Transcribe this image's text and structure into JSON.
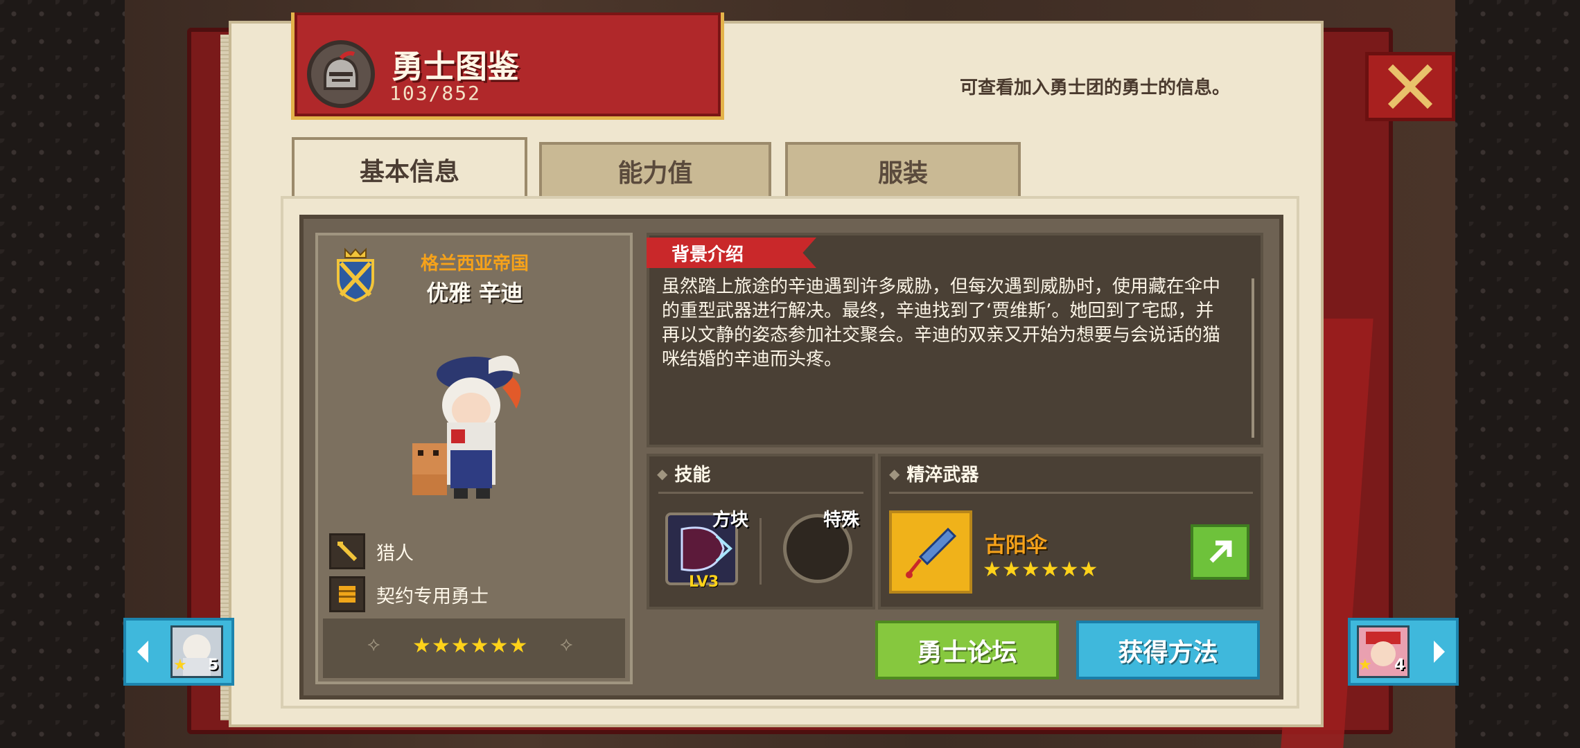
{
  "header": {
    "title": "勇士图鉴",
    "count": "103/852",
    "note": "可查看加入勇士团的勇士的信息。"
  },
  "tabs": [
    {
      "label": "基本信息",
      "active": true
    },
    {
      "label": "能力值",
      "active": false
    },
    {
      "label": "服装",
      "active": false
    }
  ],
  "hero": {
    "faction": "格兰西亚帝国",
    "name": "优雅 辛迪",
    "class": "猎人",
    "type": "契约专用勇士",
    "stars": "★★★★★★"
  },
  "background": {
    "label": "背景介绍",
    "text": "虽然踏上旅途的辛迪遇到许多威胁，但每次遇到威胁时，使用藏在伞中的重型武器进行解决。最终，辛迪找到了‘贾维斯’。她回到了宅邸，并再以文静的姿态参加社交聚会。辛迪的双亲又开始为想要与会说话的猫咪结婚的辛迪而头疼。"
  },
  "skills": {
    "label": "技能",
    "block_label": "方块",
    "block_level": "LV3",
    "special_label": "特殊"
  },
  "weapon": {
    "label": "精淬武器",
    "name": "古阳伞",
    "stars": "★★★★★★"
  },
  "buttons": {
    "forum": "勇士论坛",
    "obtain": "获得方法"
  },
  "nav": {
    "prev_stars": "5",
    "next_stars": "4"
  },
  "colors": {
    "accent_red": "#b0282a",
    "gold": "#f6a21a",
    "green_button": "#86c83e",
    "blue_button": "#3fb8dc"
  }
}
